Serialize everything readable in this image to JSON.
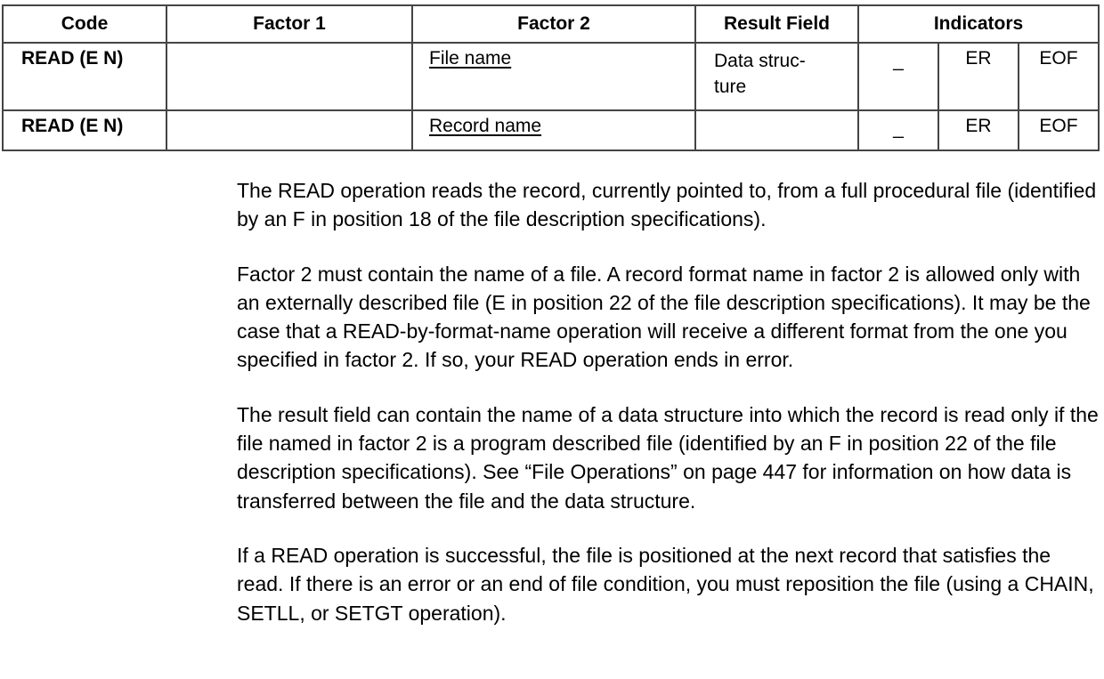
{
  "table": {
    "headers": {
      "code": "Code",
      "factor1": "Factor 1",
      "factor2": "Factor 2",
      "result": "Result Field",
      "indicators": "Indicators"
    },
    "rows": [
      {
        "code": "READ (E N)",
        "factor1": "",
        "factor2": "File name",
        "result": "Data struc-­ture",
        "result_line1": "Data struc-",
        "result_line2": "ture",
        "ind1": "_",
        "ind2": "ER",
        "ind3": "EOF"
      },
      {
        "code": "READ (E N)",
        "factor1": "",
        "factor2": "Record name",
        "result": "",
        "ind1": "_",
        "ind2": "ER",
        "ind3": "EOF"
      }
    ]
  },
  "paragraphs": [
    "The READ operation reads the record, currently pointed to, from a full procedural file (identified by an F in position 18 of the file description specifications).",
    "Factor 2 must contain the name of a file. A record format name in factor 2 is allowed only with an externally described file (E in position 22 of the file description specifications). It may be the case that a READ-by-format-name operation will receive a different format from the one you specified in factor 2. If so, your READ operation ends in error.",
    "The result field can contain the name of a data structure into which the record is read only if the file named in factor 2 is a program described file (identified by an F in position 22 of the file description specifications).  See “File Operations” on page 447 for information on how data is transferred between the file and the data structure.",
    "If a READ operation is successful, the file is positioned at the next record that satisfies the read. If there is an error or an end of file condition, you must reposition the file (using a CHAIN, SETLL, or SETGT operation)."
  ]
}
